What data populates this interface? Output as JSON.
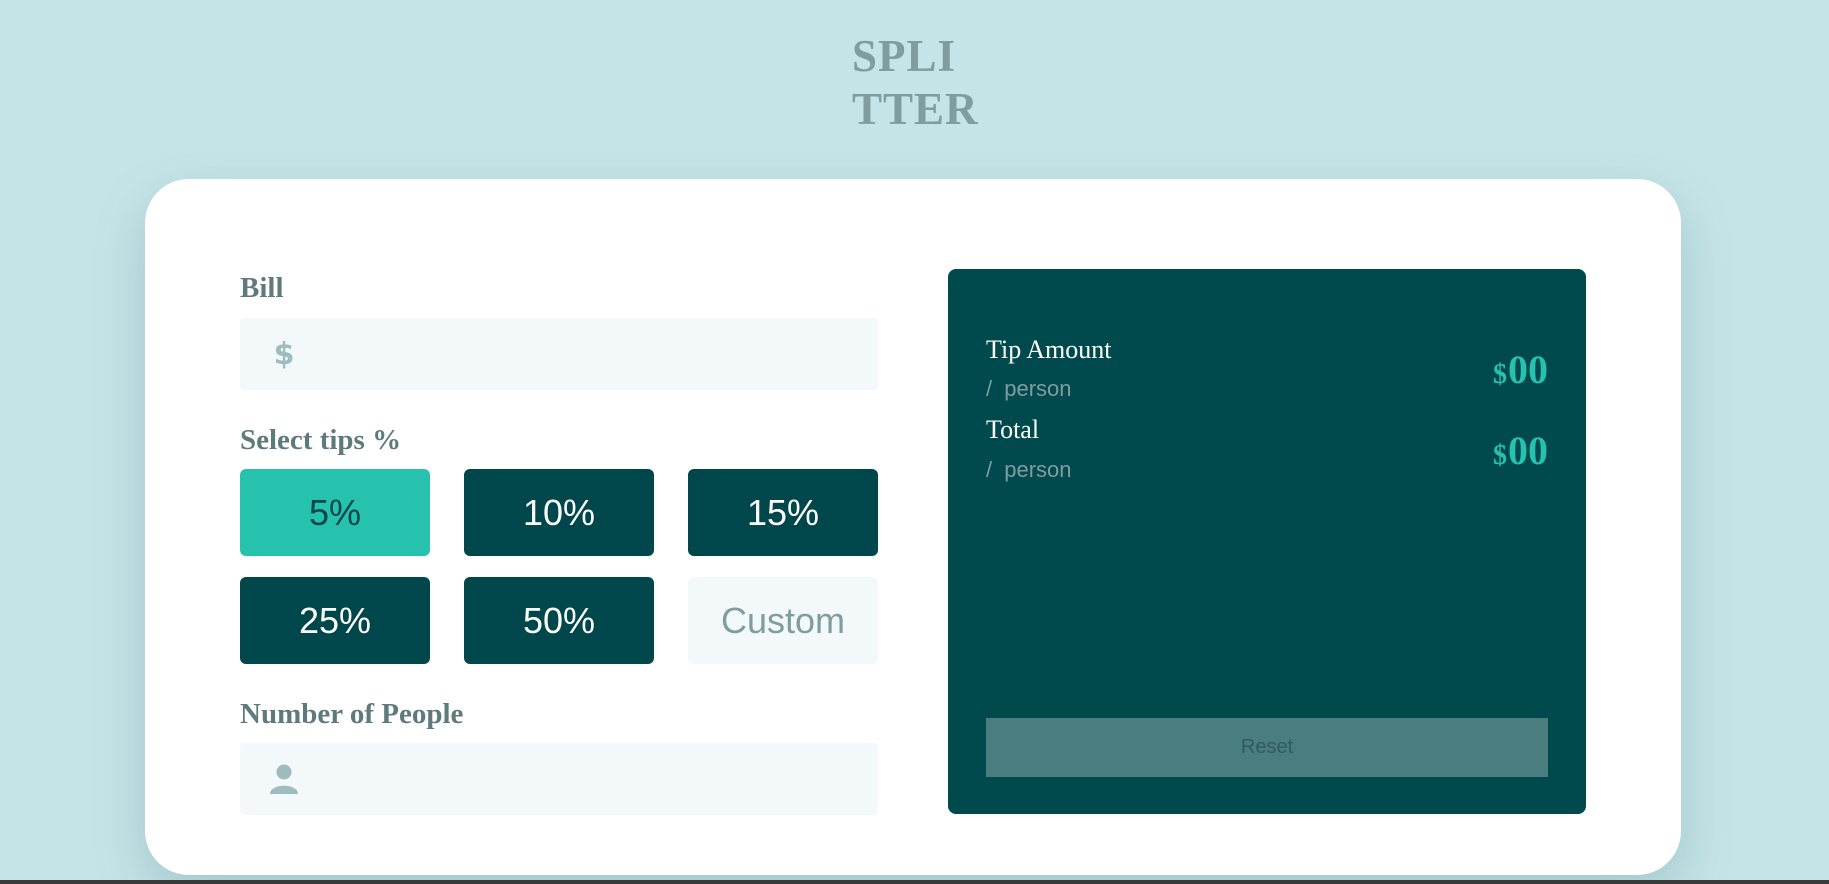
{
  "logo": {
    "line1": "SPLI",
    "line2": "TTER"
  },
  "form": {
    "bill_label": "Bill",
    "bill_icon": "dollar-icon",
    "bill_icon_glyph": "$",
    "bill_value": "",
    "tips_label": "Select tips %",
    "tips": [
      {
        "label": "5%",
        "selected": true
      },
      {
        "label": "10%",
        "selected": false
      },
      {
        "label": "15%",
        "selected": false
      },
      {
        "label": "25%",
        "selected": false
      },
      {
        "label": "50%",
        "selected": false
      }
    ],
    "custom_placeholder": "Custom",
    "people_label": "Number of People",
    "people_icon": "person-icon",
    "people_value": ""
  },
  "results": {
    "tip_label": "Tip Amount",
    "tip_sub": "/ person",
    "tip_currency": "$",
    "tip_value": "00",
    "total_label": "Total",
    "total_sub": "/ person",
    "total_currency": "$",
    "total_value": "00",
    "reset_label": "Reset"
  },
  "colors": {
    "background": "#c5e4e7",
    "strong_cyan": "#26c2ae",
    "dark_cyan": "#00474b",
    "grayish_cyan": "#7f9c9f",
    "light_cyan": "#f3f9fa"
  }
}
